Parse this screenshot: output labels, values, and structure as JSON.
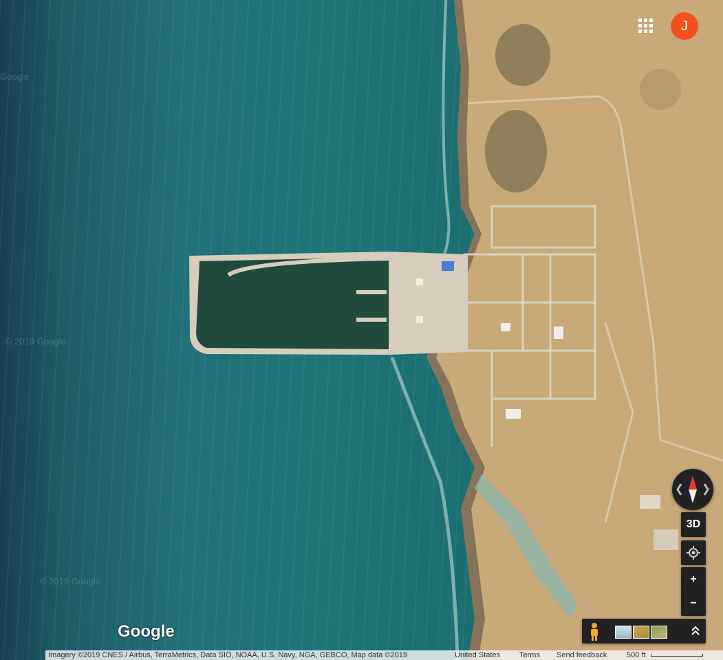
{
  "header": {
    "apps_icon": "grid-apps-icon",
    "avatar_letter": "J",
    "avatar_color": "#f4511e"
  },
  "watermarks": [
    "Google",
    "© 2019 Google",
    "© 2019 Google"
  ],
  "controls": {
    "compass_icon": "compass-icon",
    "tilt_label": "3D",
    "location_icon": "my-location-icon",
    "zoom_in_label": "+",
    "zoom_out_label": "−",
    "pegman_icon": "pegman-icon",
    "expand_icon": "chevron-up-double-icon"
  },
  "logo": "Google",
  "attribution": {
    "imagery": "Imagery ©2019 CNES / Airbus, TerraMetrics, Data SIO, NOAA, U.S. Navy, NGA, GEBCO, Map data ©2019",
    "country": "United States",
    "terms": "Terms",
    "feedback": "Send feedback",
    "scale": "500 ft"
  },
  "colors": {
    "ocean": "#1f7478",
    "sand": "#c9a97a",
    "harbor_water": "#1f4a3c",
    "control_bg": "#222222"
  }
}
